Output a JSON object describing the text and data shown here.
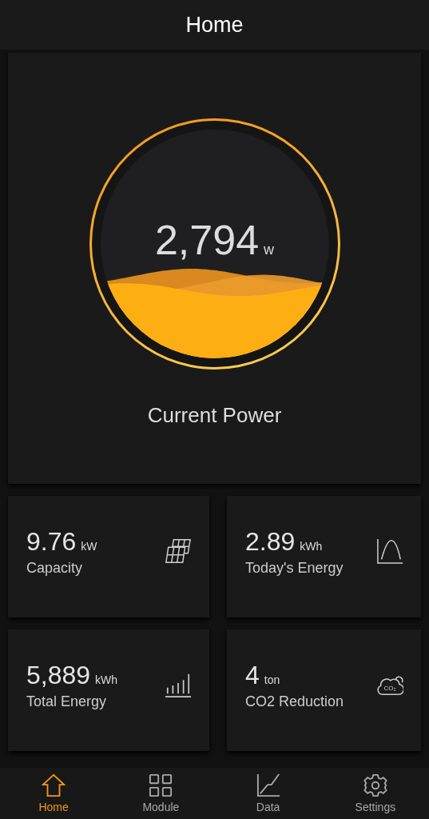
{
  "header": {
    "title": "Home"
  },
  "power": {
    "value": "2,794",
    "unit": "w",
    "label": "Current Power",
    "level": 0.36
  },
  "stats": [
    {
      "value": "9.76",
      "unit": "kW",
      "label": "Capacity",
      "kind": "solar"
    },
    {
      "value": "2.89",
      "unit": "kWh",
      "label": "Today's Energy",
      "kind": "curve"
    },
    {
      "value": "5,889",
      "unit": "kWh",
      "label": "Total Energy",
      "kind": "bars"
    },
    {
      "value": "4",
      "unit": "ton",
      "label": "CO2 Reduction",
      "kind": "co2",
      "icon_text": "CO₂"
    }
  ],
  "nav": [
    {
      "label": "Home",
      "kind": "home",
      "selected": true
    },
    {
      "label": "Module",
      "kind": "grid",
      "selected": false
    },
    {
      "label": "Data",
      "kind": "chart",
      "selected": false
    },
    {
      "label": "Settings",
      "kind": "gear",
      "selected": false
    }
  ]
}
